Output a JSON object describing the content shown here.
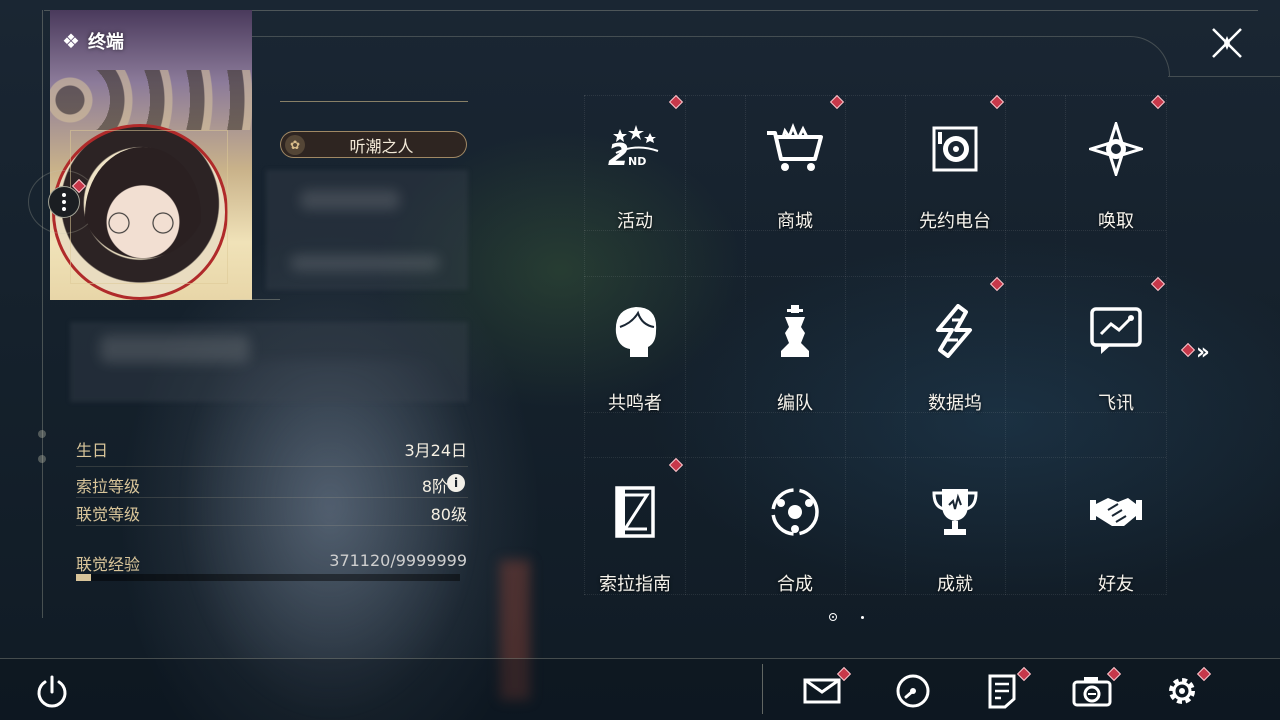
{
  "terminal": {
    "title": "终端",
    "icon": "diamond-cluster-icon"
  },
  "profile": {
    "name": "听潮之人",
    "stats": [
      {
        "label": "生日",
        "value": "3月24日"
      },
      {
        "label": "索拉等级",
        "value": "8阶"
      },
      {
        "label": "联觉等级",
        "value": "80级"
      },
      {
        "label": "联觉经验",
        "value": "371120/9999999"
      }
    ],
    "exp_current": 371120,
    "exp_max": 9999999,
    "info_icon": "i"
  },
  "menu": {
    "items": [
      {
        "label": "活动",
        "icon": "2nd-anniversary-icon",
        "badge": true
      },
      {
        "label": "商城",
        "icon": "shopping-cart-icon",
        "badge": true
      },
      {
        "label": "先约电台",
        "icon": "radio-icon",
        "badge": true
      },
      {
        "label": "唤取",
        "icon": "compass-star-icon",
        "badge": true
      },
      {
        "label": "共鸣者",
        "icon": "character-head-icon",
        "badge": false
      },
      {
        "label": "编队",
        "icon": "chess-piece-icon",
        "badge": false
      },
      {
        "label": "数据坞",
        "icon": "data-dock-icon",
        "badge": true
      },
      {
        "label": "飞讯",
        "icon": "message-bubble-icon",
        "badge": true
      },
      {
        "label": "索拉指南",
        "icon": "guide-book-icon",
        "badge": true
      },
      {
        "label": "合成",
        "icon": "synthesis-icon",
        "badge": false
      },
      {
        "label": "成就",
        "icon": "trophy-icon",
        "badge": false
      },
      {
        "label": "好友",
        "icon": "handshake-icon",
        "badge": false
      }
    ],
    "page_current": 1,
    "page_total": 2
  },
  "colors": {
    "accent_gold": "#d9c59a",
    "notify_red": "#c7384a",
    "text": "#f6f3ec"
  }
}
